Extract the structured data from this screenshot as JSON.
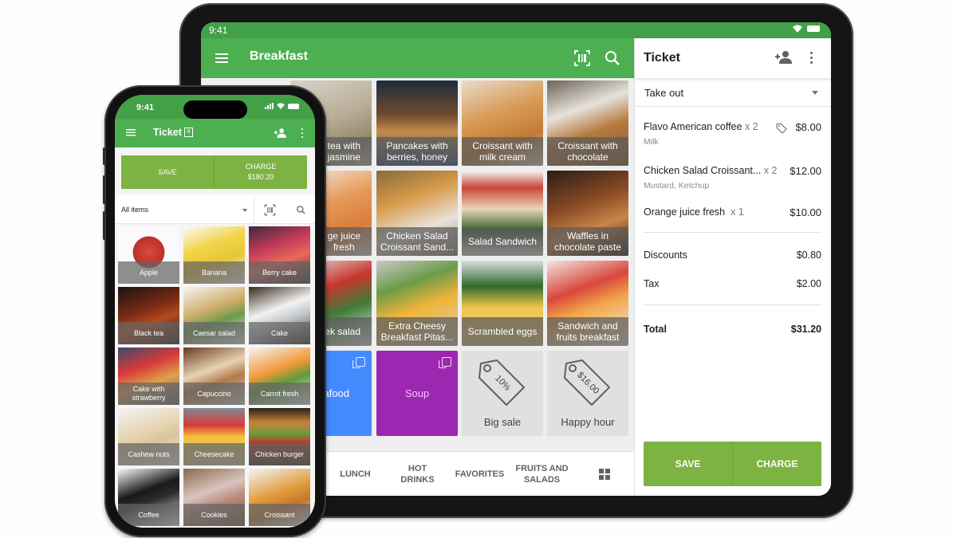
{
  "colors": {
    "primary_green": "#4caf50",
    "status_green": "#43a047",
    "button_green": "#7cb342",
    "category_blue": "#448aff",
    "category_purple": "#9c27b0",
    "discount_gray": "#e0e0e0"
  },
  "tablet": {
    "status_bar": {
      "time": "9:41",
      "icons": [
        "wifi-icon",
        "battery-icon"
      ]
    },
    "app_bar": {
      "title": "Breakfast",
      "icons": [
        "menu-icon",
        "barcode-icon",
        "search-icon"
      ]
    },
    "items": [
      {
        "label": "Green tea with jasmine",
        "visible_label": "tea with\njasmine",
        "image_hint": "teapot"
      },
      {
        "label": "Pancakes with berries, honey",
        "image_hint": "pancakes"
      },
      {
        "label": "Croissant with milk cream",
        "image_hint": "croissant"
      },
      {
        "label": "Croissant with chocolate",
        "image_hint": "croissant-choco"
      },
      {
        "label": "Orange juice fresh",
        "visible_label": "ge juice\nfresh",
        "image_hint": "juice"
      },
      {
        "label": "Chicken Salad Croissant Sand...",
        "image_hint": "sandwich"
      },
      {
        "label": "Salad Sandwich",
        "image_hint": "salad-sandwich"
      },
      {
        "label": "Waffles in chocolate paste",
        "image_hint": "waffles"
      },
      {
        "label": "Greek salad",
        "visible_label": "ek salad",
        "image_hint": "greek-salad"
      },
      {
        "label": "Extra Cheesy Breakfast Pitas...",
        "image_hint": "pitas"
      },
      {
        "label": "Scrambled eggs",
        "image_hint": "eggs"
      },
      {
        "label": "Sandwich and fruits breakfast",
        "image_hint": "fruits"
      }
    ],
    "categories": [
      {
        "label": "Seafood",
        "visible_label": "afood",
        "color": "#448aff"
      },
      {
        "label": "Soup",
        "color": "#9c27b0"
      }
    ],
    "discounts": [
      {
        "label": "Big sale",
        "tag_value": "10%"
      },
      {
        "label": "Happy hour",
        "tag_value": "$16.00"
      }
    ],
    "tabs": [
      {
        "label": "LUNCH"
      },
      {
        "label": "HOT\nDRINKS"
      },
      {
        "label": "FAVORITES"
      },
      {
        "label": "FRUITS AND\nSALADS"
      }
    ],
    "ticket": {
      "title": "Ticket",
      "dining_option": "Take out",
      "lines": [
        {
          "name": "Flavo American coffee",
          "qty": "x 2",
          "modifier": "Milk",
          "price": "$8.00",
          "has_discount_tag": true
        },
        {
          "name": "Chicken Salad Croissant...",
          "qty": "x 2",
          "modifier": "Mustard, Ketchup",
          "price": "$12.00"
        },
        {
          "name": "Orange juice fresh",
          "qty": "x 1",
          "modifier": "",
          "price": "$10.00"
        }
      ],
      "discounts_label": "Discounts",
      "discounts_value": "$0.80",
      "tax_label": "Tax",
      "tax_value": "$2.00",
      "total_label": "Total",
      "total_value": "$31.20",
      "save_label": "SAVE",
      "charge_label": "CHARGE"
    }
  },
  "phone": {
    "status_bar": {
      "time": "9:41",
      "icons": [
        "signal-icon",
        "wifi-icon",
        "battery-icon"
      ]
    },
    "app_bar": {
      "title": "Ticket",
      "count": "8"
    },
    "save_label": "SAVE",
    "charge_label": "CHARGE",
    "charge_amount": "$180.20",
    "filter": {
      "selected": "All items"
    },
    "items": [
      {
        "label": "Apple"
      },
      {
        "label": "Banana"
      },
      {
        "label": "Berry cake"
      },
      {
        "label": "Black tea"
      },
      {
        "label": "Caesar salad"
      },
      {
        "label": "Cake"
      },
      {
        "label": "Cake with strawberry"
      },
      {
        "label": "Capuccino"
      },
      {
        "label": "Carrot fresh"
      },
      {
        "label": "Cashew nuts"
      },
      {
        "label": "Cheesecake"
      },
      {
        "label": "Chicken burger"
      },
      {
        "label": "Coffee"
      },
      {
        "label": "Cookies"
      },
      {
        "label": "Croissant"
      }
    ]
  }
}
